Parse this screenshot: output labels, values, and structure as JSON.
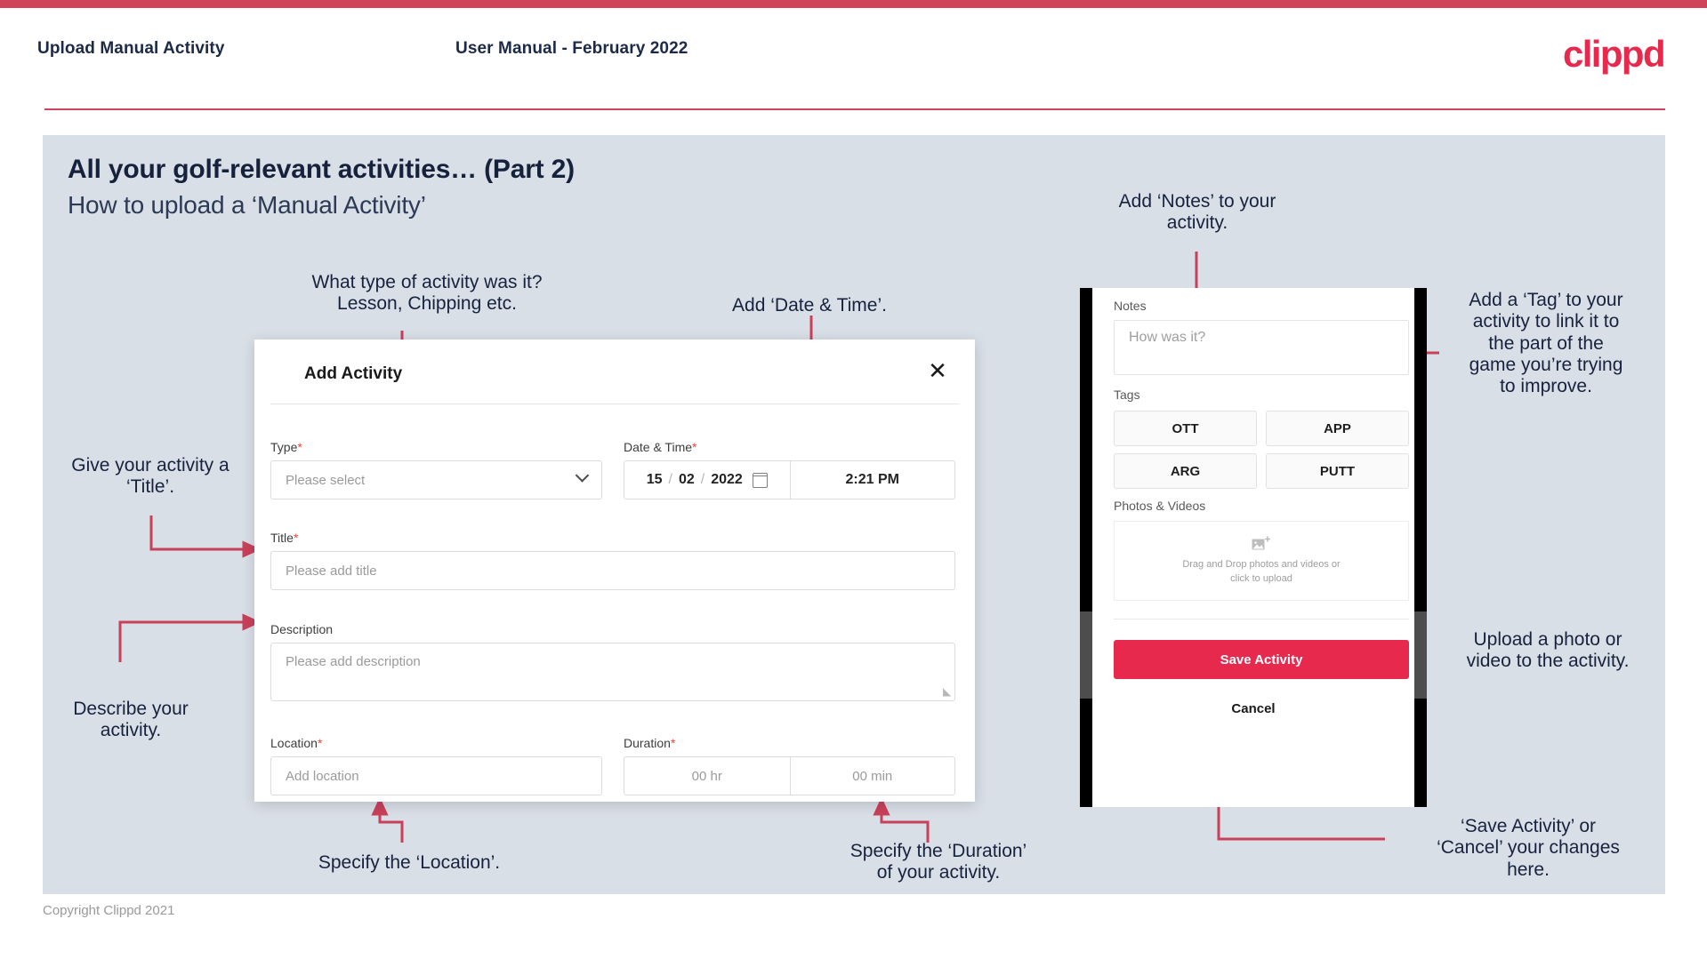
{
  "header": {
    "left_title": "Upload Manual Activity",
    "center_title": "User Manual - February 2022",
    "logo_text": "clippd",
    "accent_color": "#cf4459",
    "brand_color": "#e8294e"
  },
  "slide": {
    "title": "All your golf-relevant activities… (Part 2)",
    "subtitle": "How to upload a ‘Manual Activity’",
    "background_color": "#d9dfe6"
  },
  "modal": {
    "title": "Add Activity",
    "close_icon": "close-icon",
    "fields": {
      "type": {
        "label": "Type",
        "required": "*",
        "placeholder": "Please select",
        "chevron_icon": "chevron-down-icon"
      },
      "datetime": {
        "label": "Date & Time",
        "required": "*",
        "day": "15",
        "month": "02",
        "year": "2022",
        "sep1": "/",
        "sep2": "/",
        "calendar_icon": "calendar-icon",
        "time": "2:21 PM"
      },
      "title": {
        "label": "Title",
        "required": "*",
        "placeholder": "Please add title"
      },
      "description": {
        "label": "Description",
        "required": "",
        "placeholder": "Please add description"
      },
      "location": {
        "label": "Location",
        "required": "*",
        "placeholder": "Add location"
      },
      "duration": {
        "label": "Duration",
        "required": "*",
        "hours_placeholder": "00 hr",
        "minutes_placeholder": "00 min"
      }
    }
  },
  "phone": {
    "notes": {
      "label": "Notes",
      "placeholder": "How was it?"
    },
    "tags": {
      "label": "Tags",
      "items": [
        "OTT",
        "APP",
        "ARG",
        "PUTT"
      ]
    },
    "photos": {
      "label": "Photos & Videos",
      "icon": "add-image-icon",
      "dropzone_text": "Drag and Drop photos and videos or\nclick to upload"
    },
    "save_label": "Save Activity",
    "cancel_label": "Cancel"
  },
  "annotations": {
    "type": "What type of activity was it?\nLesson, Chipping etc.",
    "datetime": "Add ‘Date & Time’.",
    "title": "Give your activity a\n‘Title’.",
    "description": "Describe your\nactivity.",
    "location": "Specify the ‘Location’.",
    "duration": "Specify the ‘Duration’\nof your activity.",
    "notes": "Add ‘Notes’ to your\nactivity.",
    "tags": "Add a ‘Tag’ to your\nactivity to link it to\nthe part of the\ngame you’re trying\nto improve.",
    "upload": "Upload a photo or\nvideo to the activity.",
    "save": "‘Save Activity’ or\n‘Cancel’ your changes\nhere."
  },
  "footer": {
    "copyright": "Copyright Clippd 2021"
  }
}
